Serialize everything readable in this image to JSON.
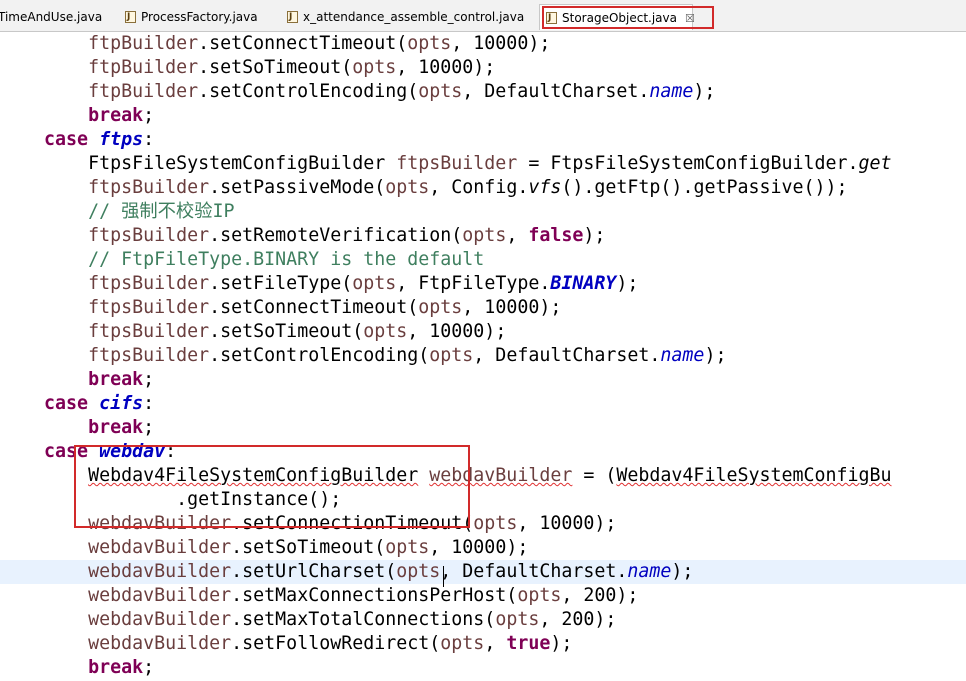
{
  "tabs": [
    {
      "label": "TimeAndUse.java"
    },
    {
      "label": "ProcessFactory.java"
    },
    {
      "label": "x_attendance_assemble_control.java"
    },
    {
      "label": "StorageObject.java",
      "active": true
    }
  ],
  "tab_close_glyph": "☒",
  "colors": {
    "keyword": "#7f0055",
    "field": "#0000c0",
    "comment": "#3f7f5f",
    "highlight": "#d22a2a"
  },
  "code": {
    "l1": {
      "obj": "ftpBuilder",
      "call": ".setConnectTimeout(",
      "var": "opts",
      "rest": ", 10000);"
    },
    "l2": {
      "obj": "ftpBuilder",
      "call": ".setSoTimeout(",
      "var": "opts",
      "rest": ", 10000);"
    },
    "l3": {
      "obj": "ftpBuilder",
      "call": ".setControlEncoding(",
      "var": "opts",
      "mid": ", DefaultCharset.",
      "field": "name",
      "end": ");"
    },
    "l4": {
      "kw": "break",
      "end": ";"
    },
    "l5": {
      "kw": "case",
      "label": "ftps",
      "end": ":"
    },
    "l6": {
      "type": "FtpsFileSystemConfigBuilder ",
      "var": "ftpsBuilder",
      "mid": " = FtpsFileSystemConfigBuilder.",
      "static": "get"
    },
    "l7": {
      "obj": "ftpsBuilder",
      "call": ".setPassiveMode(",
      "var": "opts",
      "mid": ", Config.",
      "static": "vfs",
      "end": "().getFtp().getPassive());"
    },
    "l8": {
      "comment": "// 强制不校验IP"
    },
    "l9": {
      "obj": "ftpsBuilder",
      "call": ".setRemoteVerification(",
      "var": "opts",
      "mid": ", ",
      "kw": "false",
      "end": ");"
    },
    "l10": {
      "comment": "// FtpFileType.BINARY is the default"
    },
    "l11": {
      "obj": "ftpsBuilder",
      "call": ".setFileType(",
      "var": "opts",
      "mid": ", FtpFileType.",
      "field": "BINARY",
      "end": ");"
    },
    "l12": {
      "obj": "ftpsBuilder",
      "call": ".setConnectTimeout(",
      "var": "opts",
      "rest": ", 10000);"
    },
    "l13": {
      "obj": "ftpsBuilder",
      "call": ".setSoTimeout(",
      "var": "opts",
      "rest": ", 10000);"
    },
    "l14": {
      "obj": "ftpsBuilder",
      "call": ".setControlEncoding(",
      "var": "opts",
      "mid": ", DefaultCharset.",
      "field": "name",
      "end": ");"
    },
    "l15": {
      "kw": "break",
      "end": ";"
    },
    "l16": {
      "kw": "case",
      "label": "cifs",
      "end": ":"
    },
    "l17": {
      "kw": "break",
      "end": ";"
    },
    "l18": {
      "kw": "case",
      "label": "webdav",
      "end": ":"
    },
    "l19": {
      "type": "Webdav4FileSystemConfigBuilder",
      "sp": " ",
      "var": "webdavBuilder",
      "mid": " = (",
      "type2": "Webdav4FileSystemConfigBu"
    },
    "l20": {
      "text": ".getInstance();"
    },
    "l21": {
      "obj": "webdavBuilder",
      "call": ".setConnectionTimeout(",
      "var": "opts",
      "rest": ", 10000);"
    },
    "l22": {
      "obj": "webdavBuilder",
      "call": ".setSoTimeout(",
      "var": "opts",
      "rest": ", 10000);"
    },
    "l23": {
      "obj": "webdavBuilder",
      "call": ".setUrlCharset(",
      "var": "opts",
      "mid": ", DefaultCharset.",
      "field": "name",
      "end": ");"
    },
    "l24": {
      "obj": "webdavBuilder",
      "call": ".setMaxConnectionsPerHost(",
      "var": "opts",
      "rest": ", 200);"
    },
    "l25": {
      "obj": "webdavBuilder",
      "call": ".setMaxTotalConnections(",
      "var": "opts",
      "rest": ", 200);"
    },
    "l26": {
      "obj": "webdavBuilder",
      "call": ".setFollowRedirect(",
      "var": "opts",
      "mid": ", ",
      "kw": "true",
      "end": ");"
    },
    "l27": {
      "kw": "break",
      "end": ";"
    }
  }
}
